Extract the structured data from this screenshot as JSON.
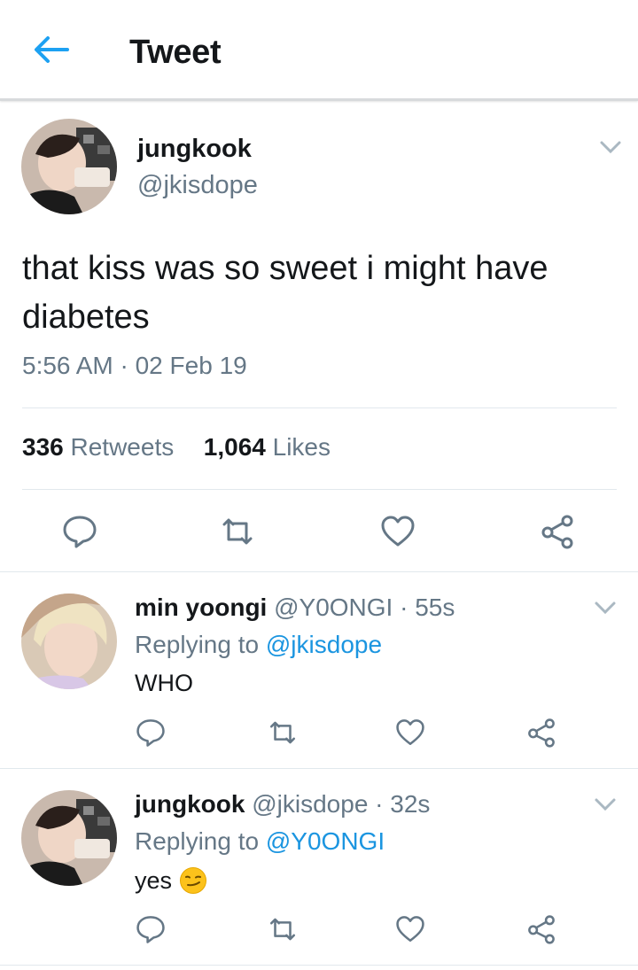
{
  "header": {
    "title": "Tweet",
    "back_icon": "arrow-left-icon",
    "accent": "#1da1f2"
  },
  "main_tweet": {
    "name": "jungkook",
    "handle": "@jkisdope",
    "text": "that kiss was so sweet i might have diabetes",
    "timestamp": "5:56 AM · 02 Feb 19",
    "retweets_count": "336",
    "retweets_label": "Retweets",
    "likes_count": "1,064",
    "likes_label": "Likes",
    "actions": [
      "reply-icon",
      "retweet-icon",
      "like-icon",
      "share-icon"
    ]
  },
  "replies": [
    {
      "name": "min yoongi",
      "meta": "@Y0ONGI · 55s",
      "replying_prefix": "Replying to",
      "replying_handle": "@jkisdope",
      "text": "WHO"
    },
    {
      "name": "jungkook",
      "meta": "@jkisdope · 32s",
      "replying_prefix": "Replying to",
      "replying_handle": "@Y0ONGI",
      "text": "yes",
      "emoji": "smirking-face-emoji"
    }
  ],
  "colors": {
    "text": "#14171a",
    "secondary": "#657786",
    "link": "#1b95e0",
    "divider": "#e1e8ed"
  }
}
